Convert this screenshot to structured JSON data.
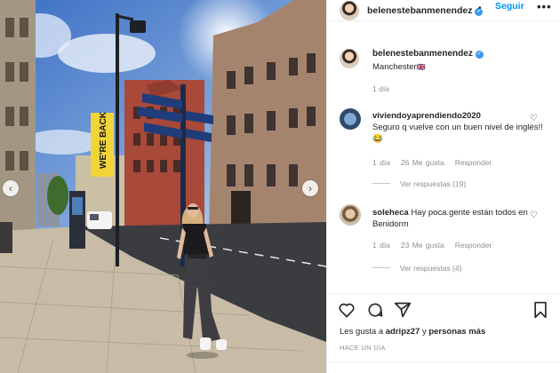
{
  "post": {
    "username": "belenestebanmenendez",
    "follow_label": "Seguir",
    "separator": "•",
    "more_label": "•••",
    "location": "Manchester",
    "location_flag": "🇬🇧",
    "time": "1 día"
  },
  "photo": {
    "banner_text": "WE'RE BACK"
  },
  "comments": [
    {
      "username": "viviendoyaprendiendo2020",
      "text": "Seguro q vuelve con un buen nivel de inglés!! 😂",
      "time": "1 día",
      "likes": "26 Me gusta",
      "reply": "Responder",
      "view_replies": "Ver respuestas (19)"
    },
    {
      "username": "soleheca",
      "text": "Hay poca.gente están todos en Benidorm",
      "time": "1 día",
      "likes": "23 Me gusta",
      "reply": "Responder",
      "view_replies": "Ver respuestas (4)"
    }
  ],
  "footer": {
    "likes_prefix": "Les gusta a",
    "likes_user": "adripz27",
    "likes_mid": "y",
    "likes_others": "personas más",
    "time_ago": "HACE UN DÍA"
  },
  "icons": [
    "heart-icon",
    "comment-icon",
    "share-icon",
    "bookmark-icon",
    "verified-icon",
    "chevron-left-icon",
    "chevron-right-icon"
  ],
  "colors": {
    "accent": "#0095f6",
    "verified": "#3897f0",
    "muted": "#8e8e8e"
  }
}
